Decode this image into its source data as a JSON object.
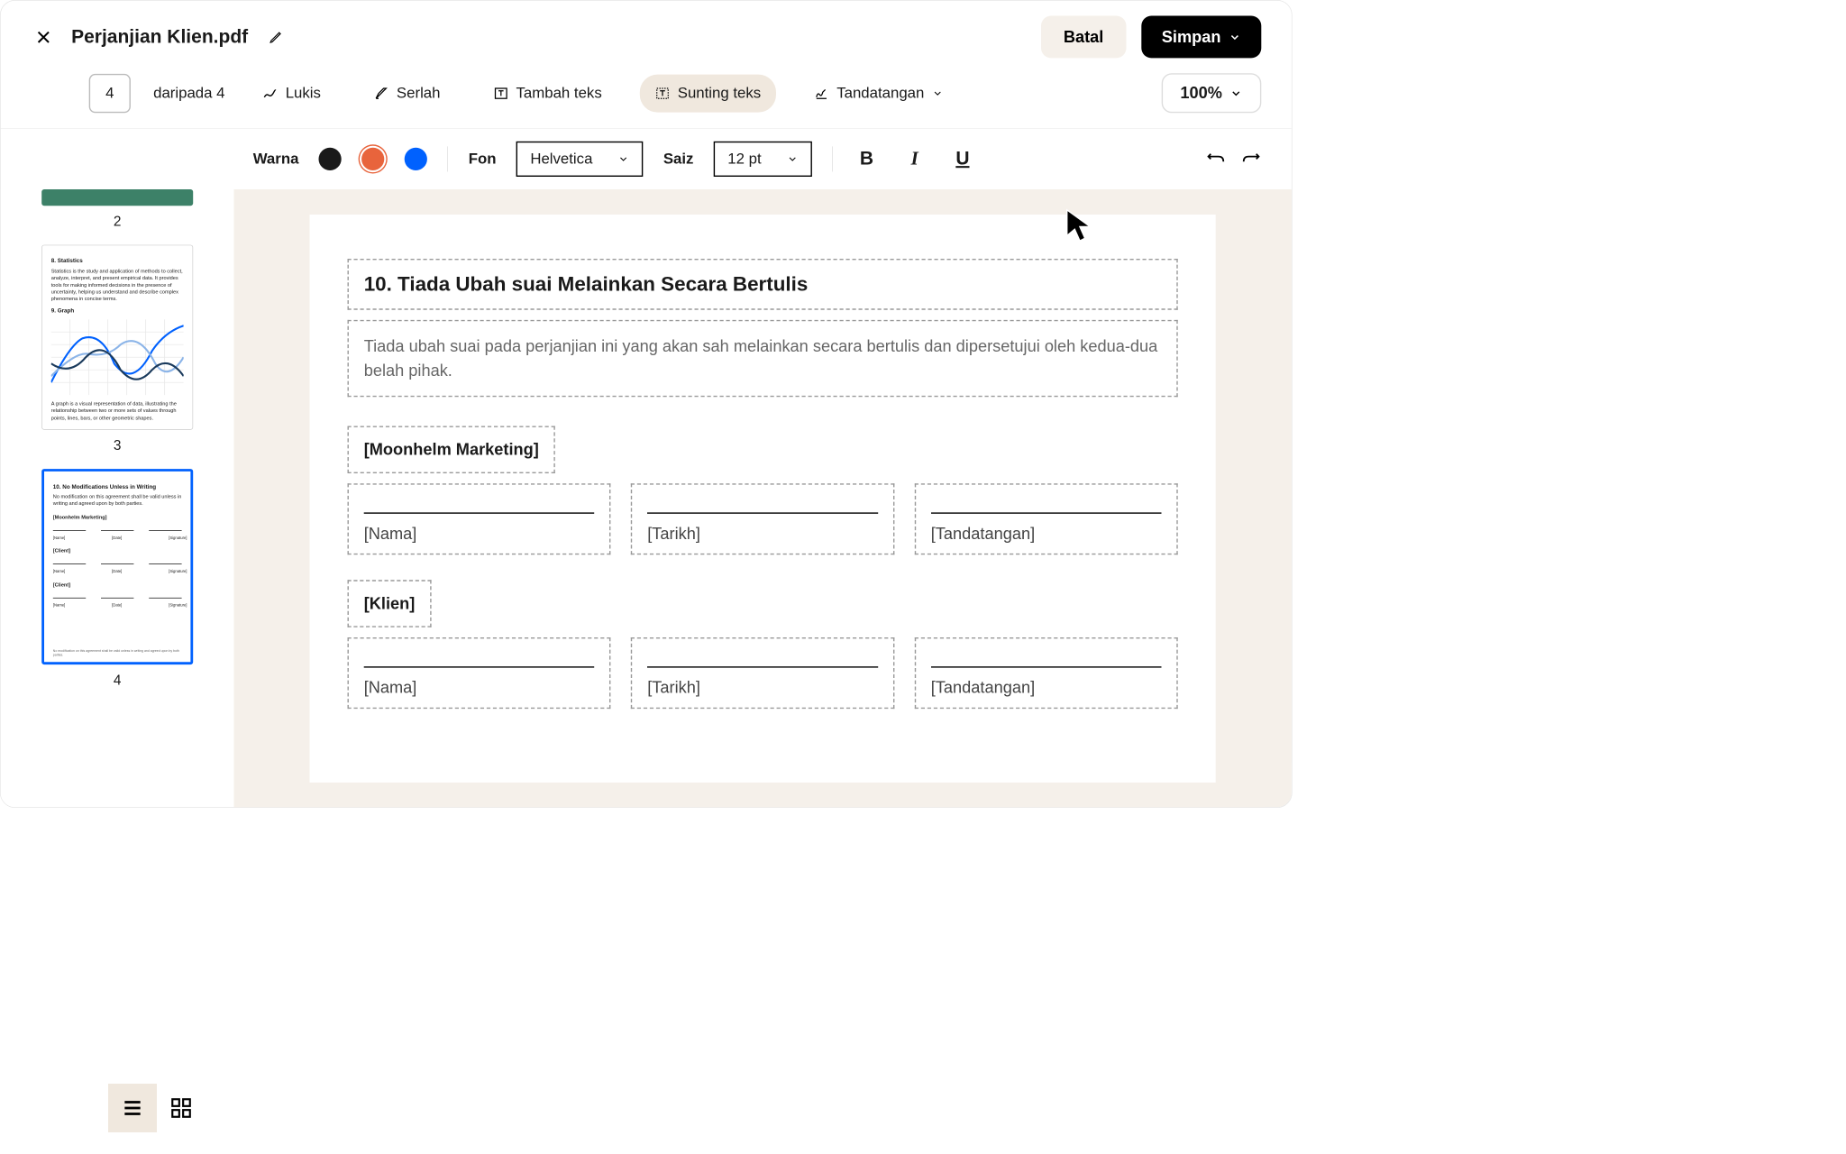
{
  "header": {
    "title": "Perjanjian Klien.pdf",
    "cancel": "Batal",
    "save": "Simpan"
  },
  "toolbar": {
    "page_current": "4",
    "page_total": "daripada 4",
    "draw": "Lukis",
    "highlight": "Serlah",
    "add_text": "Tambah teks",
    "edit_text": "Sunting teks",
    "sign": "Tandatangan",
    "zoom": "100%"
  },
  "format": {
    "color_label": "Warna",
    "colors": {
      "black": "#1a1a1a",
      "orange": "#e8643c",
      "blue": "#0061fe"
    },
    "font_label": "Fon",
    "font_value": "Helvetica",
    "size_label": "Saiz",
    "size_value": "12 pt"
  },
  "thumbs": {
    "p2": "2",
    "p3": "3",
    "p4": "4",
    "p3_content": {
      "h1": "8. Statistics",
      "body1": "Statistics is the study and application of methods to collect, analyze, interpret, and present empirical data. It provides tools for making informed decisions in the presence of uncertainty, helping us understand and describe complex phenomena in concise terms.",
      "h2": "9. Graph",
      "body2": "A graph is a visual representation of data, illustrating the relationship between two or more sets of values through points, lines, bars, or other geometric shapes."
    },
    "p4_content": {
      "h1": "10. No Modifications Unless in Writing",
      "body": "No modification on this agreement shall be valid unless in writing and agreed upon by both parties.",
      "party1": "[Moonhelm Marketing]",
      "party2": "[Client]",
      "name": "[Name]",
      "date": "[Date]",
      "sig": "[Signature]",
      "footer": "No modification on this agreement shall be valid unless in writing and agreed upon by both parties."
    }
  },
  "document": {
    "section_title": "10. Tiada Ubah suai Melainkan Secara Bertulis",
    "section_body": "Tiada ubah suai pada perjanjian ini yang akan sah melainkan secara bertulis dan dipersetujui oleh kedua-dua belah pihak.",
    "party1": "[Moonhelm Marketing]",
    "party2": "[Klien]",
    "name": "[Nama]",
    "date": "[Tarikh]",
    "signature": "[Tandatangan]"
  }
}
